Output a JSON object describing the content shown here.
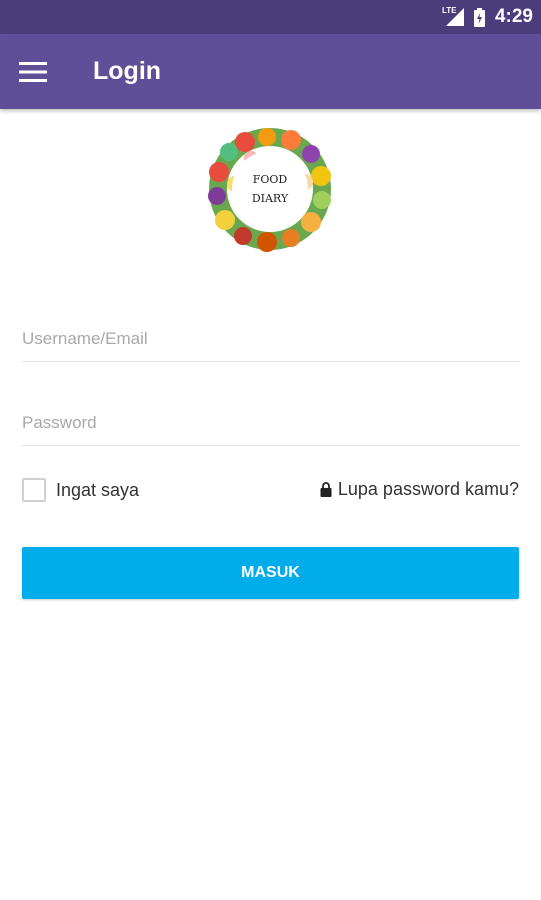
{
  "status_bar": {
    "network": "LTE",
    "time": "4:29"
  },
  "app_bar": {
    "title": "Login"
  },
  "logo": {
    "line1": "FOOD",
    "line2": "DIARY"
  },
  "form": {
    "username_placeholder": "Username/Email",
    "password_placeholder": "Password",
    "remember_label": "Ingat saya",
    "remember_checked": false,
    "forgot_label": "Lupa password kamu?",
    "submit_label": "MASUK"
  },
  "colors": {
    "status_bar": "#4a3d7c",
    "app_bar": "#5e4f98",
    "button": "#00acea"
  }
}
